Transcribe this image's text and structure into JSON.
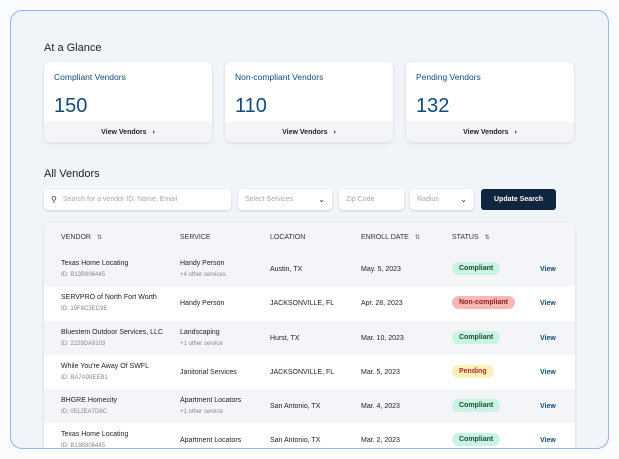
{
  "glance": {
    "title": "At a Glance",
    "cards": [
      {
        "title": "Compliant Vendors",
        "count": "150",
        "link": "View Vendors"
      },
      {
        "title": "Non-compliant Vendors",
        "count": "110",
        "link": "View Vendors"
      },
      {
        "title": "Pending Vendors",
        "count": "132",
        "link": "View Vendors"
      }
    ]
  },
  "vendors": {
    "title": "All Vendors",
    "search_placeholder": "Search for a vendor ID, Name, Email",
    "services_placeholder": "Select Services",
    "zip_placeholder": "Zip Code",
    "radius_placeholder": "Radius",
    "update_label": "Update Search",
    "columns": [
      "VENDOR",
      "SERVICE",
      "LOCATION",
      "ENROLL DATE",
      "STATUS"
    ],
    "view_label": "View",
    "status_colors": {
      "Compliant": [
        "#c9f4e2",
        "#1f4a3a"
      ],
      "Non-compliant": [
        "#f8b8b8",
        "#8a1c1c"
      ],
      "Pending": [
        "#fdf0b8",
        "#b3262b"
      ]
    },
    "rows": [
      {
        "name": "Texas Home Locating",
        "id": "ID: B13B806445",
        "service": "Handy Person",
        "extra": "+4 other services",
        "location": "Austin, TX",
        "date": "May. 5, 2023",
        "status": "Compliant"
      },
      {
        "name": "SERVPRO of North Fort Worth",
        "id": "ID: 19F8C3EC9E",
        "service": "Handy Person",
        "extra": "",
        "location": "JACKSONVILLE, FL",
        "date": "Apr. 28, 2023",
        "status": "Non-compliant"
      },
      {
        "name": "Bluestem Outdoor Services, LLC",
        "id": "ID: 2229DA9103",
        "service": "Landscaping",
        "extra": "+1 other service",
        "location": "Hurst, TX",
        "date": "Mar. 10, 2023",
        "status": "Compliant"
      },
      {
        "name": "While You're Away Of SWFL",
        "id": "ID: BA7A98EEB1",
        "service": "Janitorial Services",
        "extra": "",
        "location": "JACKSONVILLE, FL",
        "date": "Mar. 5, 2023",
        "status": "Pending"
      },
      {
        "name": "BHGRE Homecity",
        "id": "ID: 0512EA7D8C",
        "service": "Apartment Locators",
        "extra": "+1 other service",
        "location": "San Antonio, TX",
        "date": "Mar. 4, 2023",
        "status": "Compliant"
      },
      {
        "name": "Texas Home Locating",
        "id": "ID: B13B806445",
        "service": "Apartment Locators",
        "extra": "",
        "location": "San Antonio, TX",
        "date": "Mar. 2, 2023",
        "status": "Compliant"
      }
    ]
  }
}
